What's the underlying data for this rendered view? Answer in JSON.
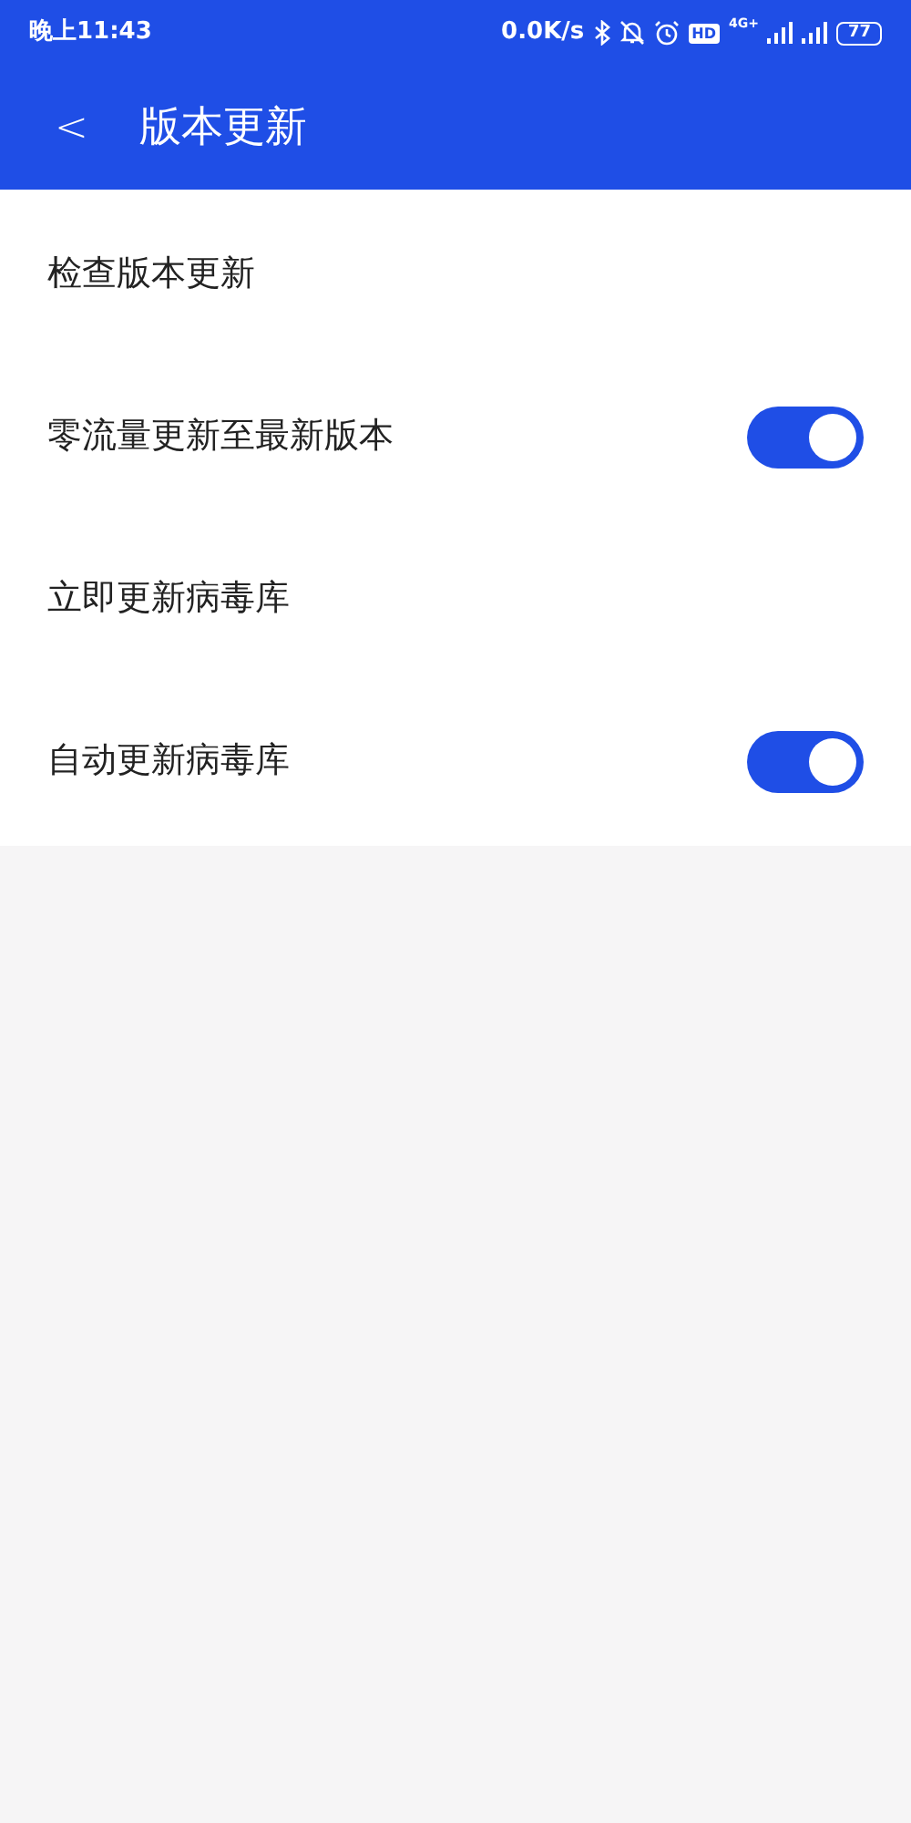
{
  "status_bar": {
    "time": "晚上11:43",
    "speed": "0.0K/s",
    "hd": "HD",
    "network": "4G+",
    "battery": "77"
  },
  "header": {
    "back": "<",
    "title": "版本更新"
  },
  "settings": [
    {
      "kind": "link",
      "label": "检查版本更新"
    },
    {
      "kind": "switch",
      "label": "零流量更新至最新版本",
      "on": true
    },
    {
      "kind": "link",
      "label": "立即更新病毒库"
    },
    {
      "kind": "switch",
      "label": "自动更新病毒库",
      "on": true
    }
  ]
}
